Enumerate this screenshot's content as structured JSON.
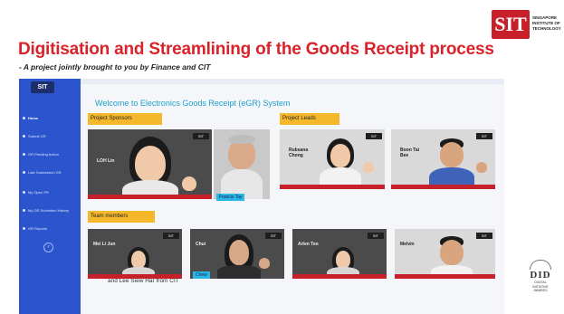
{
  "slide": {
    "title": "Digitisation and Streamlining of the Goods Receipt process",
    "subtitle": "- A project jointly brought to you by Finance and CIT"
  },
  "brand": {
    "logo_mark": "SIT",
    "logo_text": [
      "SINGAPORE",
      "INSTITUTE OF",
      "TECHNOLOGY"
    ]
  },
  "app": {
    "logo_label": "SIT",
    "nav_items": [
      {
        "label": "Home",
        "active": true
      },
      {
        "label": "Submit GR",
        "active": false
      },
      {
        "label": "GR Pending Action",
        "active": false
      },
      {
        "label": "Late Submission GR",
        "active": false
      },
      {
        "label": "My Open PR",
        "active": false
      },
      {
        "label": "My GR Submitted History",
        "active": false
      },
      {
        "label": "GR Reports",
        "active": false
      }
    ],
    "nav_toggle_icon": "chevron-left-icon",
    "welcome": "Welcome to Electronics Goods Receipt (eGR) System",
    "sections": {
      "sponsors": "Project Sponsors",
      "leads": "Project Leads",
      "team": "Team members"
    },
    "sponsors": [
      {
        "nameplate": "LOH Lin",
        "caption": ""
      },
      {
        "nameplate": "",
        "caption": "Francis Tay"
      }
    ],
    "leads": [
      {
        "nameplate": "Rubsana Chong",
        "caption": ""
      },
      {
        "nameplate": "Boon Tai Bee",
        "caption": ""
      }
    ],
    "team": [
      {
        "nameplate": "Mei Li Jun",
        "caption": ""
      },
      {
        "nameplate": "Chui",
        "caption": "Chew"
      },
      {
        "nameplate": "Arlen Teo",
        "caption": ""
      },
      {
        "nameplate": "Melvin",
        "caption": ""
      }
    ],
    "tile_logo": "SIT",
    "footer": "and Lee Siew Har from CIT"
  },
  "award": {
    "mark": "DID",
    "lines": [
      "DIGITAL",
      "INITIATIVE",
      "AWARDS"
    ]
  },
  "colors": {
    "title_red": "#d8232a",
    "sidebar_blue": "#2c54cc",
    "label_amber": "#f6b82b",
    "welcome_teal": "#1ea0c8",
    "caption_cyan": "#2bb7e6"
  }
}
